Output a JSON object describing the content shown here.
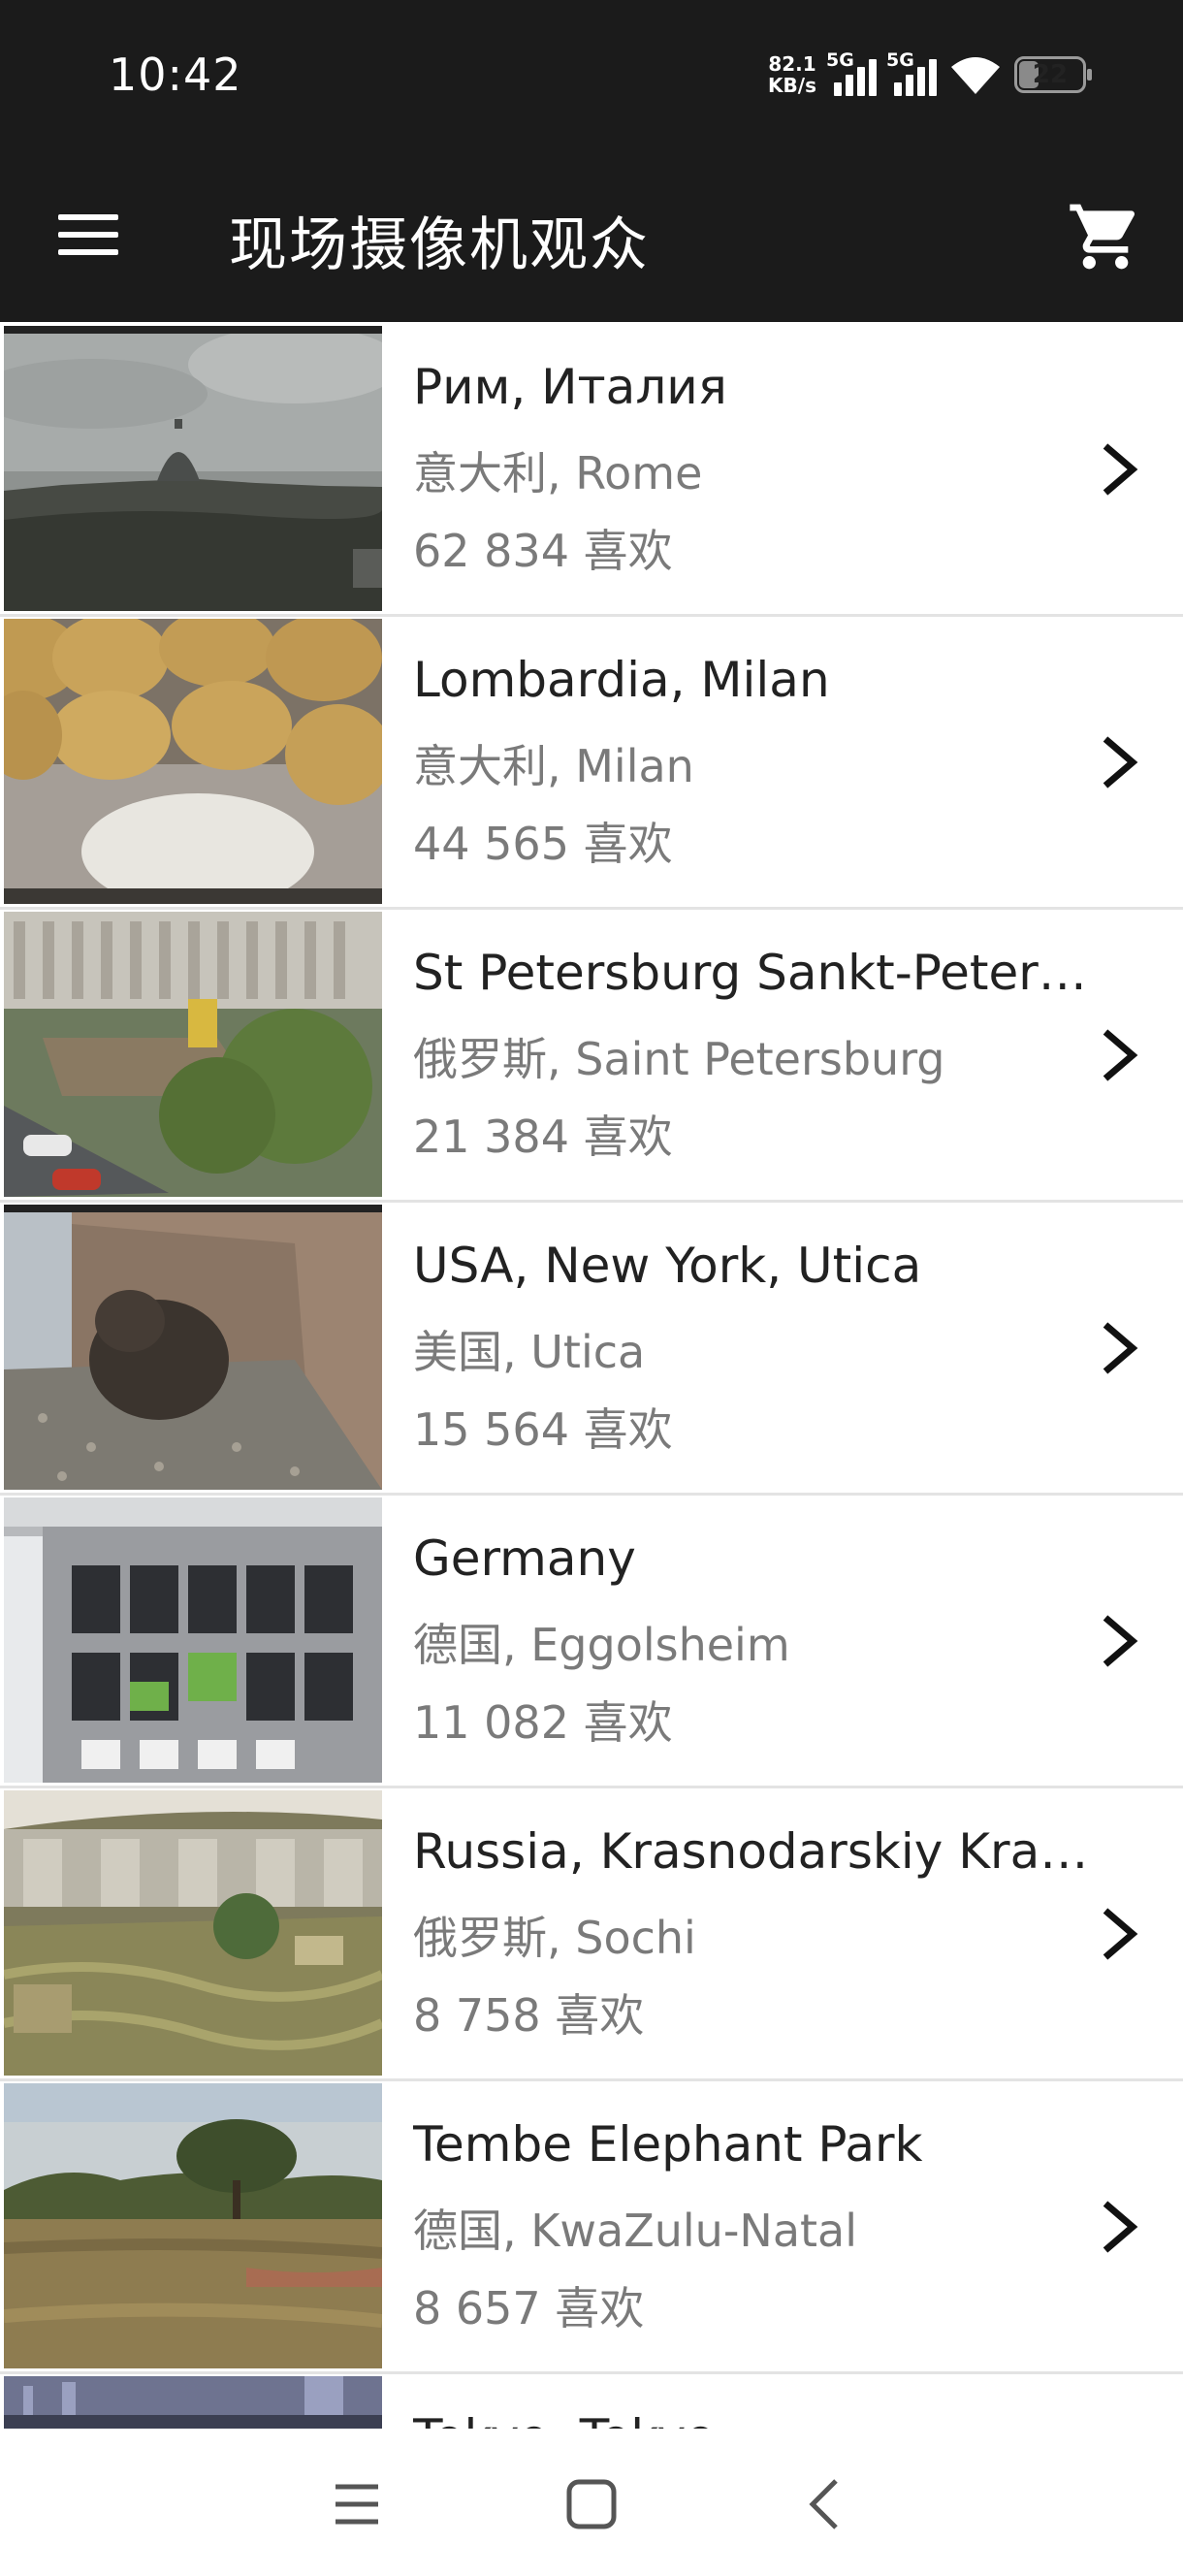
{
  "status_bar": {
    "time": "10:42",
    "net_speed_value": "82.1",
    "net_speed_unit": "KB/s",
    "sim1_label": "5G",
    "sim2_label": "5G",
    "battery_level": "22"
  },
  "app_bar": {
    "title": "现场摄像机观众",
    "menu_icon": "menu-icon",
    "cart_icon": "cart-icon"
  },
  "cameras": [
    {
      "title": "Рим, Италия",
      "location": "意大利, Rome",
      "likes": "62 834 喜欢"
    },
    {
      "title": "Lombardia, Milan",
      "location": "意大利, Milan",
      "likes": "44 565 喜欢"
    },
    {
      "title": "St Petersburg Sankt-Peter…",
      "location": "俄罗斯, Saint Petersburg",
      "likes": "21 384 喜欢"
    },
    {
      "title": "USA, New York, Utica",
      "location": "美国, Utica",
      "likes": "15 564 喜欢"
    },
    {
      "title": "Germany",
      "location": "德国, Eggolsheim",
      "likes": "11 082 喜欢"
    },
    {
      "title": "Russia, Krasnodarskiy Kray…",
      "location": "俄罗斯, Sochi",
      "likes": "8 758 喜欢"
    },
    {
      "title": "Tembe Elephant Park",
      "location": "德国, KwaZulu-Natal",
      "likes": "8 657 喜欢"
    },
    {
      "title": "Tokyo, Tokyo",
      "location": "",
      "likes": ""
    }
  ],
  "nav_bar": {
    "recents_icon": "recents-icon",
    "home_icon": "home-icon",
    "back_icon": "back-icon"
  },
  "colors": {
    "bar_background": "#1b1b1b",
    "title_text": "#222222",
    "secondary_text": "#7a7a7a",
    "divider": "#e3e3e3"
  }
}
